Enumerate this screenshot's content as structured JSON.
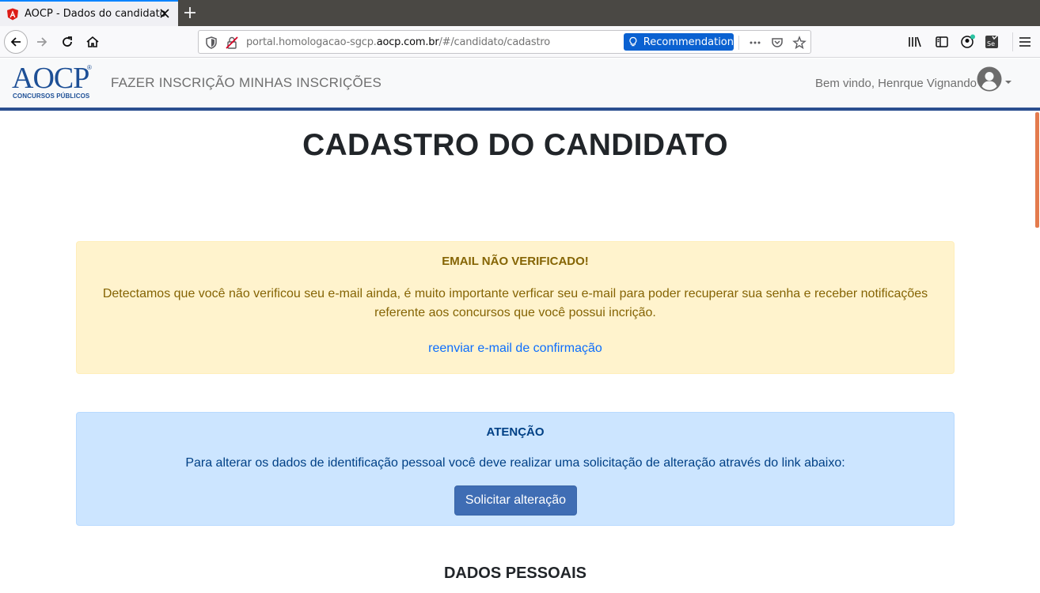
{
  "browser": {
    "tab_title": "AOCP - Dados do candidato",
    "url_prefix": "portal.homologacao-sgcp.",
    "url_domain": "aocp.com.br",
    "url_suffix": "/#/candidato/cadastro",
    "recommendation_label": "Recommendation",
    "accent_color": "#0a84ff"
  },
  "header": {
    "logo_text": "AOCP",
    "logo_reg": "®",
    "logo_subtitle": "CONCURSOS PÚBLICOS",
    "menu": [
      {
        "label": "FAZER INSCRIÇÃO"
      },
      {
        "label": "MINHAS INSCRIÇÕES"
      }
    ],
    "welcome": "Bem vindo, Henrque Vignando",
    "brand_color": "#2b4f8f"
  },
  "main": {
    "page_title": "CADASTRO DO CANDIDATO",
    "email_alert": {
      "title": "EMAIL NÃO VERIFICADO!",
      "body": "Detectamos que você não verificou seu e-mail ainda, é muito importante verficar seu e-mail para poder recuperar sua senha e receber notificações referente aos concursos que você possui incrição.",
      "link": "reenviar e-mail de confirmação"
    },
    "attention_alert": {
      "title": "ATENÇÃO",
      "body": "Para alterar os dados de identificação pessoal você deve realizar uma solicitação de alteração através do link abaixo:",
      "button": "Solicitar alteração"
    },
    "section_title": "DADOS PESSOAIS"
  }
}
